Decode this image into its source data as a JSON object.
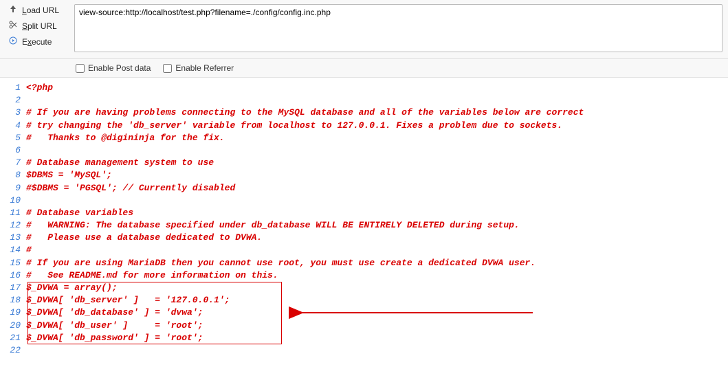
{
  "toolbar": {
    "load_url": "Load URL",
    "split_url": "Split URL",
    "execute": "Execute",
    "url_value": "view-source:http://localhost/test.php?filename=./config/config.inc.php"
  },
  "checkboxes": {
    "enable_post": "Enable Post data",
    "enable_referrer": "Enable Referrer"
  },
  "source": {
    "lines": [
      {
        "n": "1",
        "t": "<?php"
      },
      {
        "n": "2",
        "t": ""
      },
      {
        "n": "3",
        "t": "# If you are having problems connecting to the MySQL database and all of the variables below are correct"
      },
      {
        "n": "4",
        "t": "# try changing the 'db_server' variable from localhost to 127.0.0.1. Fixes a problem due to sockets."
      },
      {
        "n": "5",
        "t": "#   Thanks to @digininja for the fix."
      },
      {
        "n": "6",
        "t": ""
      },
      {
        "n": "7",
        "t": "# Database management system to use"
      },
      {
        "n": "8",
        "t": "$DBMS = 'MySQL';"
      },
      {
        "n": "9",
        "t": "#$DBMS = 'PGSQL'; // Currently disabled"
      },
      {
        "n": "10",
        "t": ""
      },
      {
        "n": "11",
        "t": "# Database variables"
      },
      {
        "n": "12",
        "t": "#   WARNING: The database specified under db_database WILL BE ENTIRELY DELETED during setup."
      },
      {
        "n": "13",
        "t": "#   Please use a database dedicated to DVWA."
      },
      {
        "n": "14",
        "t": "#"
      },
      {
        "n": "15",
        "t": "# If you are using MariaDB then you cannot use root, you must use create a dedicated DVWA user."
      },
      {
        "n": "16",
        "t": "#   See README.md for more information on this."
      },
      {
        "n": "17",
        "t": "$_DVWA = array();"
      },
      {
        "n": "18",
        "t": "$_DVWA[ 'db_server' ]   = '127.0.0.1';"
      },
      {
        "n": "19",
        "t": "$_DVWA[ 'db_database' ] = 'dvwa';"
      },
      {
        "n": "20",
        "t": "$_DVWA[ 'db_user' ]     = 'root';"
      },
      {
        "n": "21",
        "t": "$_DVWA[ 'db_password' ] = 'root';"
      },
      {
        "n": "22",
        "t": ""
      }
    ]
  },
  "annotation": {
    "box": {
      "top_line": 17,
      "bottom_line": 21
    },
    "arrow_color": "#d90000"
  }
}
